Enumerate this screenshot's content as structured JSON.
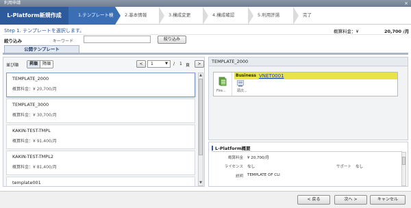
{
  "window": {
    "title": "利用申請",
    "close_glyph": "×"
  },
  "app_title": "L-Platform新規作成",
  "steps": [
    {
      "label": "1.テンプレート検索",
      "active": true
    },
    {
      "label": "2.基本情報",
      "active": false
    },
    {
      "label": "3.構成変更",
      "active": false
    },
    {
      "label": "4.構成確認",
      "active": false
    },
    {
      "label": "5.利用許諾",
      "active": false
    },
    {
      "label": "完了",
      "active": false
    }
  ],
  "step_instruction": "Step 1. テンプレートを選択します。",
  "monthly_fee": {
    "label": "概算料金：¥",
    "value": "20,700 /月"
  },
  "filter": {
    "label": "絞り込み",
    "keyword_label": "キーワード",
    "keyword_value": "",
    "button": "絞り込み"
  },
  "tab_public": "公開テンプレート",
  "sort": {
    "label": "並び順",
    "options": [
      "昇順",
      "降順"
    ],
    "selected": "昇順"
  },
  "pager": {
    "prev": "<",
    "current": "1",
    "slash": "/",
    "total": "1",
    "unit": "頁",
    "next": ">"
  },
  "templates": [
    {
      "name": "TEMPLATE_2000",
      "price": "概算料金：¥ 20,700/月",
      "selected": true
    },
    {
      "name": "TEMPLATE_3000",
      "price": "概算料金：¥ 30,700/月",
      "selected": false
    },
    {
      "name": "KAKIN-TEST-TMPL",
      "price": "概算料金：¥ 91,400/月",
      "selected": false
    },
    {
      "name": "KAKIN-TEST-TMPL2",
      "price": "概算料金：¥ 81,400/月",
      "selected": false
    },
    {
      "name": "template001",
      "price": "",
      "selected": false
    }
  ],
  "detail": {
    "title": "TEMPLATE_2000",
    "server_caption": "Fire...",
    "network_type": "Business",
    "network_name": "VNET0001",
    "vm_caption": "頭次..."
  },
  "summary": {
    "title": "L-Platform概要",
    "fee_label": "概算料金",
    "fee_value": "¥ 20,700/月",
    "license_label": "ライセンス",
    "license_value": "なし",
    "support_label": "サポート",
    "support_value": "なし",
    "desc_label": "説明",
    "desc_value": "TEMPLATE OF CLI"
  },
  "footer": {
    "back": "< 戻る",
    "next": "次へ >",
    "cancel": "キャンセル"
  },
  "colors": {
    "accent": "#2d5a9c",
    "step_active": "#3b6fb5",
    "network_bar": "#e8e34a"
  }
}
